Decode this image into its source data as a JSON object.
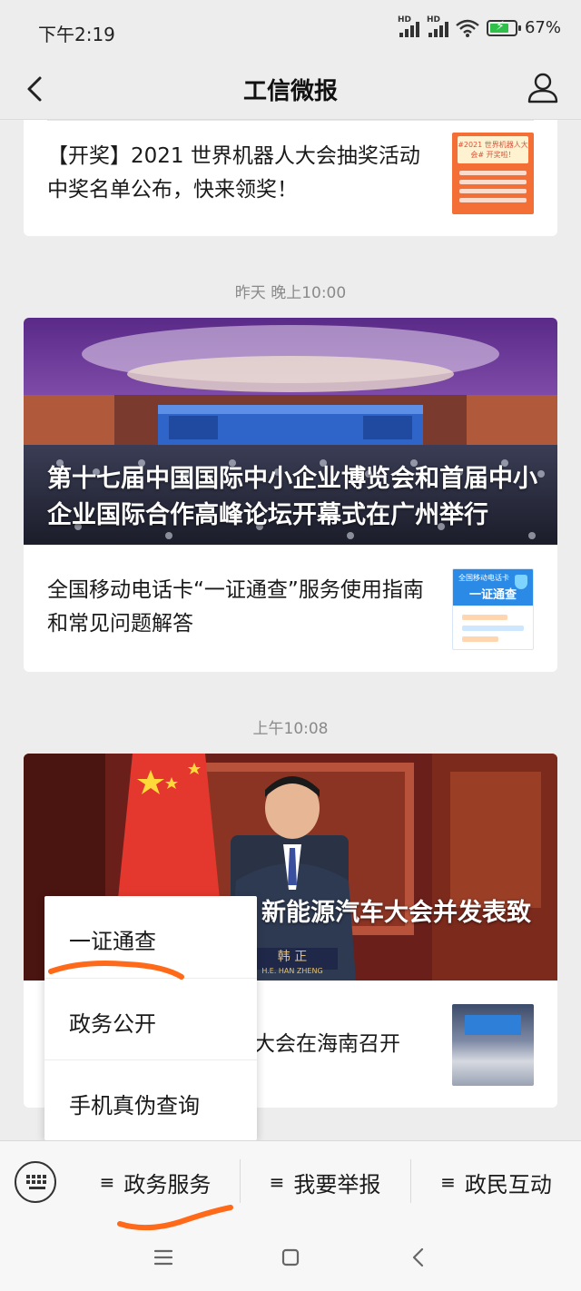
{
  "status_bar": {
    "time": "下午2:19",
    "network_1": "HD",
    "network_2": "HD",
    "battery": "67%"
  },
  "nav": {
    "title": "工信微报",
    "icons": {
      "back": "chevron-left-icon",
      "profile": "user-profile-icon"
    }
  },
  "feed": {
    "card1": {
      "title": "【开奖】2021 世界机器人大会抽奖活动中奖名单公布，快来领奖！",
      "thumb_text": "#2021 世界机器人大会# 开奖啦！"
    },
    "time_label_1": "昨天 晚上10:00",
    "card2": {
      "hero_title": "第十七届中国国际中小企业博览会和首届中小企业国际合作高峰论坛开幕式在广州举行",
      "item_title": "全国移动电话卡“一证通查”服务使用指南和常见问题解答",
      "thumb_header": "全国移动电话卡",
      "thumb_title": "一证通查"
    },
    "time_label_2": "上午10:08",
    "card3": {
      "hero_title_visible": "新能源汽车大会并发表致",
      "nameplate": "韩 正",
      "nameplate_en": "H.E. HAN ZHENG",
      "item_title_visible": "大会在海南召开"
    }
  },
  "popup_menu": {
    "items": [
      "一证通查",
      "政务公开",
      "手机真伪查询"
    ]
  },
  "menu_bar": {
    "keyboard_icon": "keyboard-icon",
    "tabs": [
      {
        "glyph": "≡",
        "label": "政务服务"
      },
      {
        "glyph": "≡",
        "label": "我要举报"
      },
      {
        "glyph": "≡",
        "label": "政民互动"
      }
    ]
  },
  "android_nav": {
    "icons": [
      "menu-icon",
      "home-square-icon",
      "back-triangle-icon"
    ]
  },
  "colors": {
    "annotation": "#ff6a1a",
    "background": "#ededed",
    "card": "#ffffff"
  }
}
